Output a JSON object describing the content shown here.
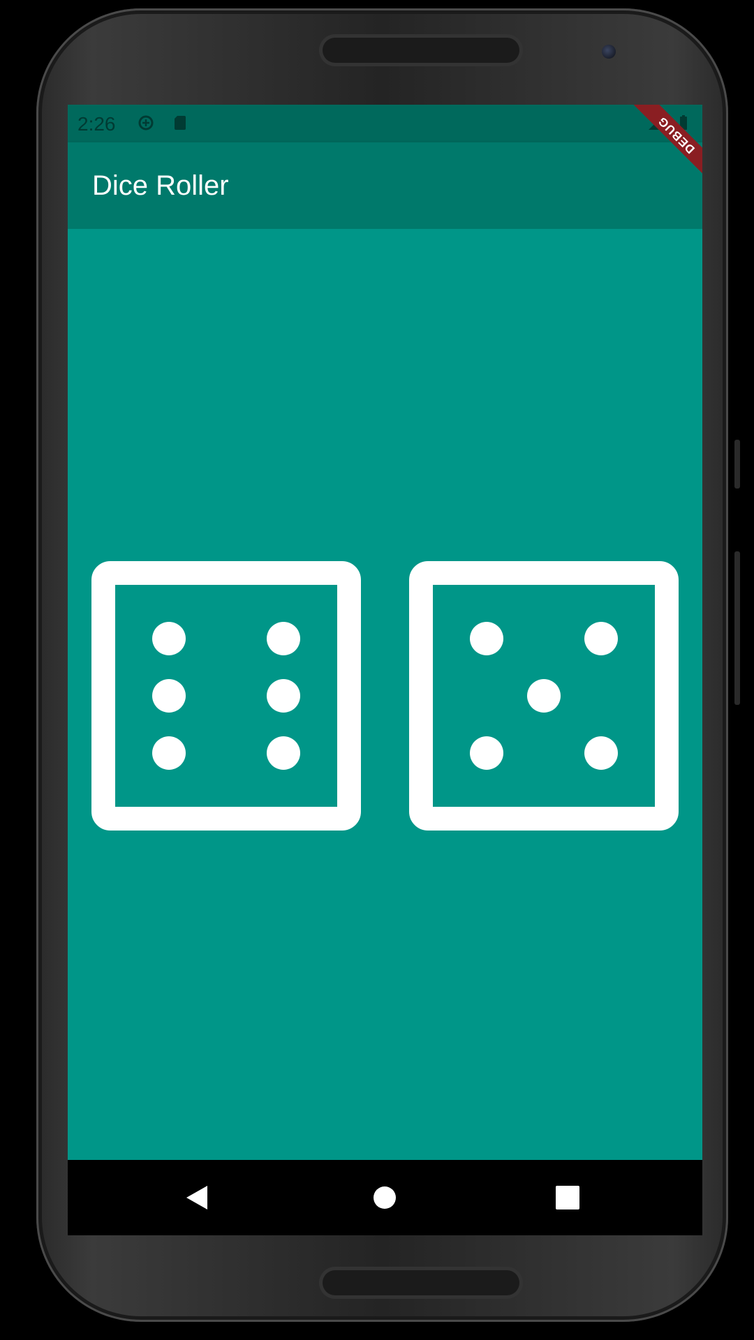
{
  "status_bar": {
    "time": "2:26",
    "icons": [
      "data-saver-icon",
      "sd-card-icon",
      "signal-icon",
      "battery-icon"
    ]
  },
  "app_bar": {
    "title": "Dice Roller",
    "debug_banner": "DEBUG"
  },
  "dice": {
    "left": {
      "value": 6,
      "icon": "dice-six-icon"
    },
    "right": {
      "value": 5,
      "icon": "dice-five-icon"
    }
  },
  "colors": {
    "background": "#009688",
    "app_bar": "#00796b",
    "status_bar": "#00695c",
    "die_face": "#ffffff",
    "debug_banner": "#8a1e22"
  },
  "nav_bar": {
    "buttons": [
      "back-icon",
      "home-icon",
      "recents-icon"
    ]
  }
}
